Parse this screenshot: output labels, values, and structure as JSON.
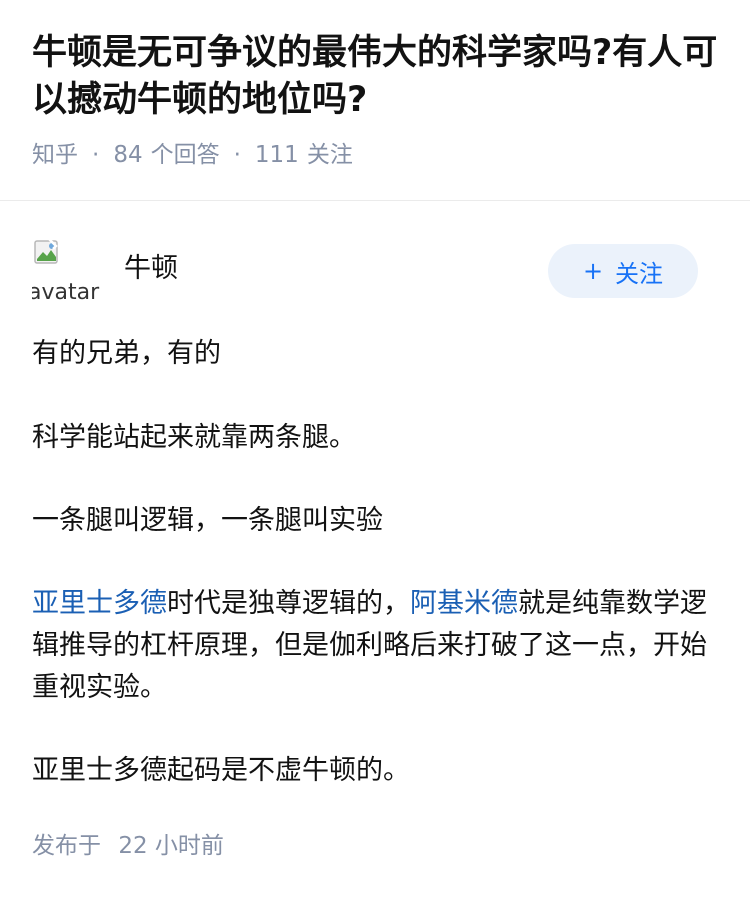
{
  "question": {
    "title": "牛顿是无可争议的最伟大的科学家吗?有人可以撼动牛顿的地位吗?",
    "source": "知乎",
    "answer_count": "84",
    "answer_label": "个回答",
    "follower_count": "111",
    "follower_label": "关注",
    "separator": "·"
  },
  "answer": {
    "author": {
      "name": "牛顿",
      "avatar_alt": "avatar",
      "follow_plus": "+",
      "follow_label": "关注"
    },
    "paragraphs": {
      "p1": "有的兄弟，有的",
      "p2": "科学能站起来就靠两条腿。",
      "p3": "一条腿叫逻辑，一条腿叫实验",
      "p4": {
        "link1": "亚里士多德",
        "text1": "时代是独尊逻辑的，",
        "link2": "阿基米德",
        "text2": "就是纯靠数学逻辑推导的杠杆原理，但是伽利略后来打破了这一点，开始重视实验。"
      },
      "p5": "亚里士多德起码是不虚牛顿的。"
    },
    "publish": {
      "label": "发布于",
      "time": "22 小时前"
    }
  },
  "colors": {
    "link": "#175199",
    "meta": "#8590a6",
    "follow_bg": "#ebf2fb",
    "follow_text": "#1772f6"
  },
  "icons": {
    "avatar": "broken-image-icon"
  }
}
